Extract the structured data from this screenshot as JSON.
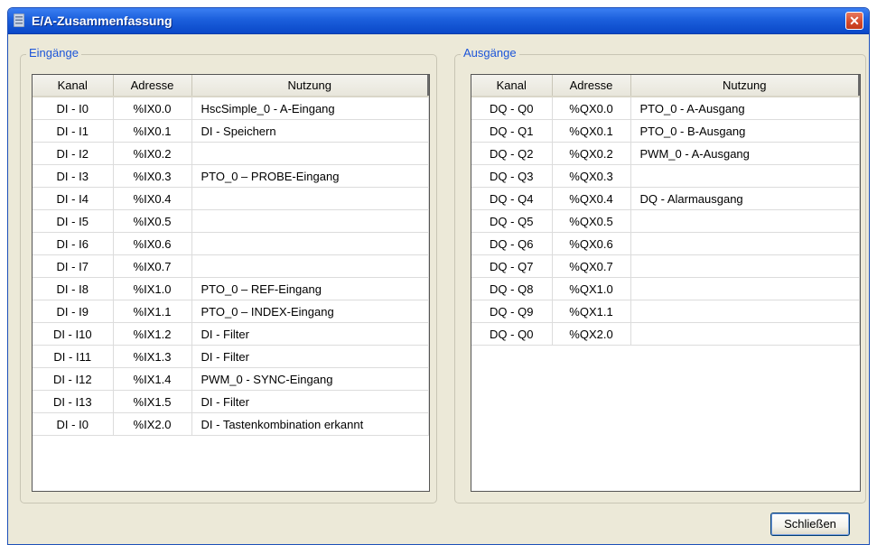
{
  "window": {
    "title": "E/A-Zusammenfassung"
  },
  "columns": {
    "kanal": "Kanal",
    "adresse": "Adresse",
    "nutzung": "Nutzung"
  },
  "inputs": {
    "label": "Eingänge",
    "rows": [
      {
        "kanal": "DI - I0",
        "adresse": "%IX0.0",
        "nutzung": "HscSimple_0 - A-Eingang"
      },
      {
        "kanal": "DI - I1",
        "adresse": "%IX0.1",
        "nutzung": "DI - Speichern"
      },
      {
        "kanal": "DI - I2",
        "adresse": "%IX0.2",
        "nutzung": ""
      },
      {
        "kanal": "DI - I3",
        "adresse": "%IX0.3",
        "nutzung": "PTO_0 – PROBE-Eingang"
      },
      {
        "kanal": "DI - I4",
        "adresse": "%IX0.4",
        "nutzung": ""
      },
      {
        "kanal": "DI - I5",
        "adresse": "%IX0.5",
        "nutzung": ""
      },
      {
        "kanal": "DI - I6",
        "adresse": "%IX0.6",
        "nutzung": ""
      },
      {
        "kanal": "DI - I7",
        "adresse": "%IX0.7",
        "nutzung": ""
      },
      {
        "kanal": "DI - I8",
        "adresse": "%IX1.0",
        "nutzung": "PTO_0 – REF-Eingang"
      },
      {
        "kanal": "DI - I9",
        "adresse": "%IX1.1",
        "nutzung": "PTO_0 – INDEX-Eingang"
      },
      {
        "kanal": "DI - I10",
        "adresse": "%IX1.2",
        "nutzung": "DI - Filter"
      },
      {
        "kanal": "DI - I11",
        "adresse": "%IX1.3",
        "nutzung": "DI - Filter"
      },
      {
        "kanal": "DI - I12",
        "adresse": "%IX1.4",
        "nutzung": "PWM_0 - SYNC-Eingang"
      },
      {
        "kanal": "DI - I13",
        "adresse": "%IX1.5",
        "nutzung": "DI - Filter"
      },
      {
        "kanal": "DI - I0",
        "adresse": "%IX2.0",
        "nutzung": "DI - Tastenkombination erkannt"
      }
    ]
  },
  "outputs": {
    "label": "Ausgänge",
    "rows": [
      {
        "kanal": "DQ - Q0",
        "adresse": "%QX0.0",
        "nutzung": "PTO_0 - A-Ausgang"
      },
      {
        "kanal": "DQ - Q1",
        "adresse": "%QX0.1",
        "nutzung": "PTO_0 - B-Ausgang"
      },
      {
        "kanal": "DQ - Q2",
        "adresse": "%QX0.2",
        "nutzung": "PWM_0 - A-Ausgang"
      },
      {
        "kanal": "DQ - Q3",
        "adresse": "%QX0.3",
        "nutzung": ""
      },
      {
        "kanal": "DQ - Q4",
        "adresse": "%QX0.4",
        "nutzung": "DQ - Alarmausgang"
      },
      {
        "kanal": "DQ - Q5",
        "adresse": "%QX0.5",
        "nutzung": ""
      },
      {
        "kanal": "DQ - Q6",
        "adresse": "%QX0.6",
        "nutzung": ""
      },
      {
        "kanal": "DQ - Q7",
        "adresse": "%QX0.7",
        "nutzung": ""
      },
      {
        "kanal": "DQ - Q8",
        "adresse": "%QX1.0",
        "nutzung": ""
      },
      {
        "kanal": "DQ - Q9",
        "adresse": "%QX1.1",
        "nutzung": ""
      },
      {
        "kanal": "DQ - Q0",
        "adresse": "%QX2.0",
        "nutzung": ""
      }
    ]
  },
  "buttons": {
    "close_label": "Schließen"
  },
  "icons": {
    "app": "window-icon",
    "close": "close-icon"
  },
  "colors": {
    "titlebar": "#0a48c8",
    "legend": "#1c55d9",
    "background": "#ece9d8"
  }
}
